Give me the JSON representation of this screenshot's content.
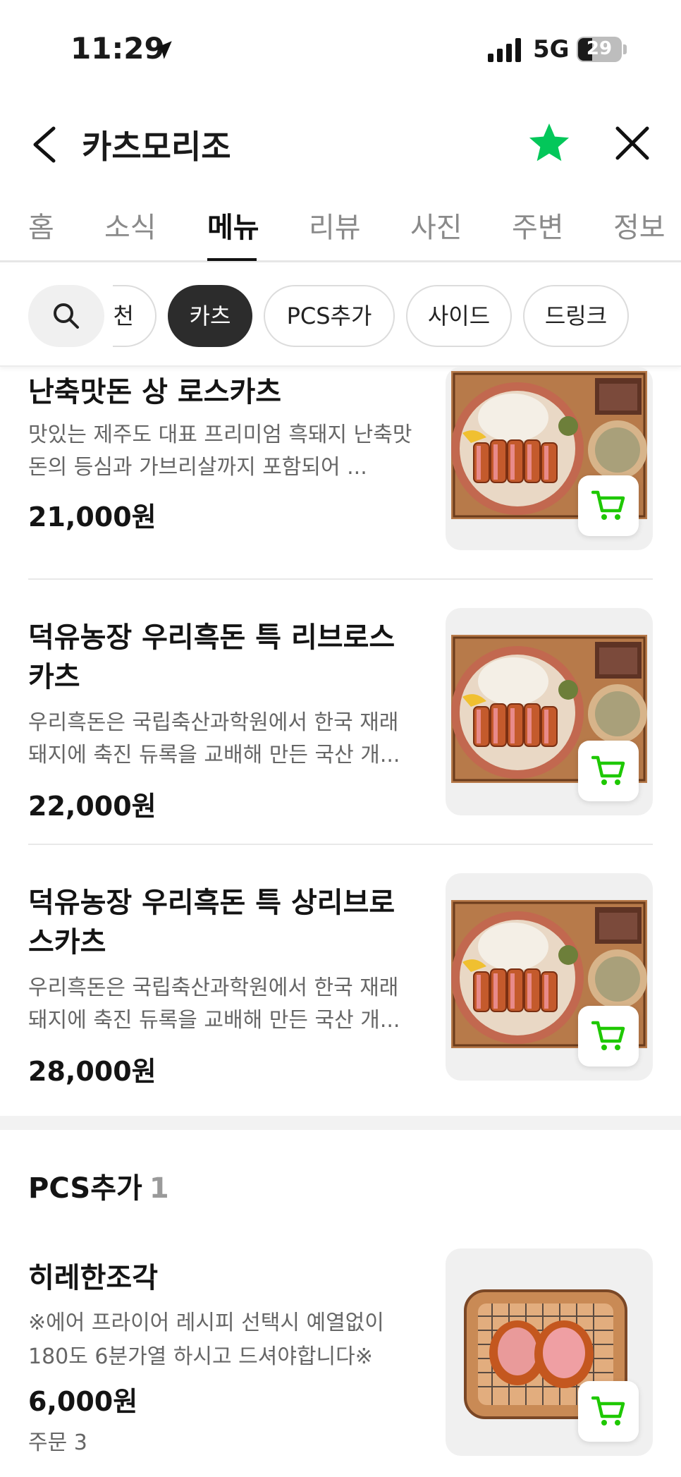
{
  "status_bar": {
    "time": "11:29",
    "network": "5G",
    "battery": "29"
  },
  "header": {
    "title": "카츠모리조"
  },
  "tabs": [
    "홈",
    "소식",
    "메뉴",
    "리뷰",
    "사진",
    "주변",
    "정보"
  ],
  "active_tab": "메뉴",
  "filters": {
    "chips": [
      {
        "label": "천",
        "active": false
      },
      {
        "label": "카츠",
        "active": true
      },
      {
        "label": "PCS추가",
        "active": false
      },
      {
        "label": "사이드",
        "active": false
      },
      {
        "label": "드링크",
        "active": false
      }
    ]
  },
  "menu_items": [
    {
      "name": "난축맛돈 상 로스카츠",
      "description": "맛있는 제주도 대표 프리미엄 흑돼지 난축맛돈의 등심과 가브리살까지 포함되어 ...",
      "price": "21,000원"
    },
    {
      "name": "덕유농장 우리흑돈 특 리브로스카츠",
      "description": "우리흑돈은 국립축산과학원에서 한국 재래돼지에 축진 듀록을 교배해 만든 국산 개...",
      "price": "22,000원"
    },
    {
      "name": "덕유농장 우리흑돈 특 상리브로스카츠",
      "description": "우리흑돈은 국립축산과학원에서 한국 재래돼지에 축진 듀록을 교배해 만든 국산 개...",
      "price": "28,000원"
    }
  ],
  "section": {
    "title": "PCS추가",
    "count": "1",
    "items": [
      {
        "name": "히레한조각",
        "description": "※에어 프라이어 레시피 선택시 예열없이 180도 6분가열 하시고 드셔야합니다※",
        "price": "6,000원",
        "order": "주문 3"
      }
    ]
  },
  "colors": {
    "accent_green": "#1ec800",
    "star_green": "#03c75a",
    "active_chip": "#2c2c2c"
  }
}
